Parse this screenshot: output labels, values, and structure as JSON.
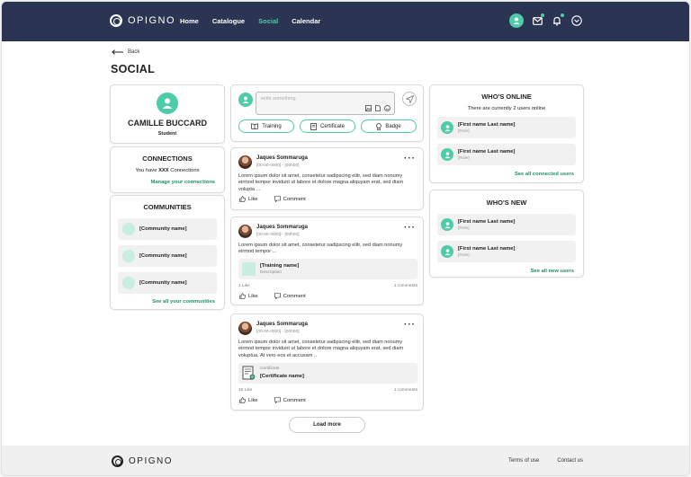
{
  "header": {
    "brand": "OPIGNO",
    "nav": [
      {
        "label": "Home",
        "active": false
      },
      {
        "label": "Catalogue",
        "active": false
      },
      {
        "label": "Social",
        "active": true
      },
      {
        "label": "Calendar",
        "active": false
      }
    ],
    "accent": "#4ecba9",
    "bg": "#2b3452"
  },
  "page": {
    "back_label": "Back",
    "title": "SOCIAL"
  },
  "profile": {
    "name": "CAMILLE BUCCARD",
    "role": "Student"
  },
  "connections": {
    "title": "CONNECTIONS",
    "text_prefix": "You have",
    "count": "XXX",
    "text_suffix": "Connections",
    "manage_link": "Manage your connections"
  },
  "communities": {
    "title": "COMMUNITIES",
    "items": [
      "[Community name]",
      "[Community name]",
      "[Community name]"
    ],
    "see_all": "See all your communities"
  },
  "composer": {
    "placeholder": "write something",
    "buttons": [
      "Training",
      "Certificate",
      "Badge"
    ]
  },
  "posts": [
    {
      "author": "Jaques Sommaruga",
      "date": "[00-00-0000] - [00h00]",
      "text": "Lorem ipsum dolor sit amet, consetetur sadipscing elitr, sed diam nonumy eirmod tempor invidunt ut labore et dolore magna aliquyam erat, sed diam volupta ...",
      "like": "Like",
      "comment": "Comment"
    },
    {
      "author": "Jaques Sommaruga",
      "date": "[00-00-0000] - [00h00]",
      "text": "Lorem ipsum dolor sit amet, consetetur sadipscing elitr, sed diam nonumy eirmod tempor ...",
      "attachment_title": "[Training name]",
      "attachment_sub": "Description",
      "likes_count": "1 Like",
      "comments_count": "1 comments",
      "like": "Like",
      "comment": "Comment"
    },
    {
      "author": "Jaques Sommaruga",
      "date": "[00-00-0000] - [00h00]",
      "text": "Lorem ipsum dolor sit amet, consetetur sadipscing elitr, sed diam nonumy eirmod tempor invidunt ut labore et dolore magna aliquyam erat, sed diam voluptua. At vero eos et accusam ..",
      "attachment_label": "Certificate",
      "attachment_title": "[Certificate name]",
      "likes_count": "10 Like",
      "comments_count": "1 comments",
      "like": "Like",
      "comment": "Comment"
    }
  ],
  "load_more": "Load more",
  "whos_online": {
    "title": "WHO'S ONLINE",
    "subtitle": "There are currently 2 users online",
    "users": [
      {
        "name": "[First name Last name]",
        "role": "[Role]"
      },
      {
        "name": "[First name Last name]",
        "role": "[Role]"
      }
    ],
    "see_all": "See all connected users"
  },
  "whos_new": {
    "title": "WHO'S NEW",
    "users": [
      {
        "name": "[First name Last name]",
        "role": "[Role]"
      },
      {
        "name": "[First name Last name]",
        "role": "[Role]"
      }
    ],
    "see_all": "See all new users"
  },
  "footer": {
    "brand": "OPIGNO",
    "links": [
      "Terms of use",
      "Contact us"
    ]
  }
}
